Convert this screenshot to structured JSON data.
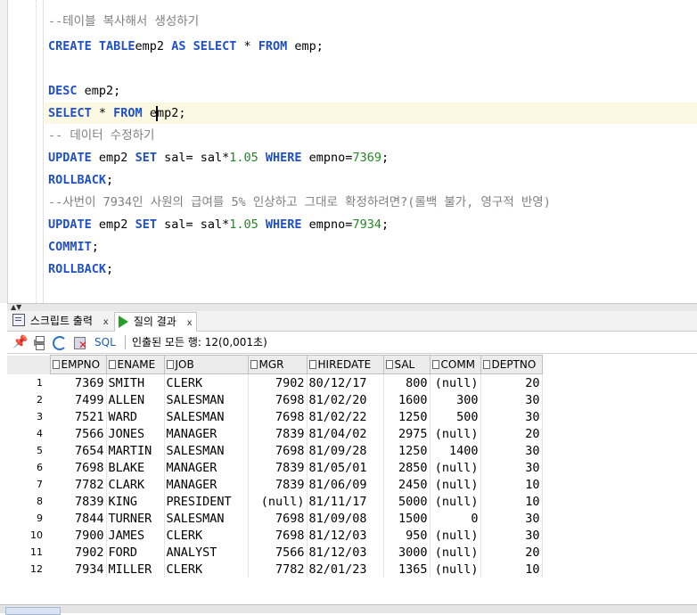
{
  "editor": {
    "lines": [
      {
        "t": "cm",
        "text": "--테이블 복사해서 생성하기"
      },
      {
        "t": "code",
        "parts": [
          [
            "kw",
            "CREATE TABLE"
          ],
          [
            "",
            "emp2 "
          ],
          [
            "kw",
            "AS SELECT"
          ],
          [
            "",
            " * "
          ],
          [
            "kw",
            "FROM"
          ],
          [
            "",
            " emp;"
          ]
        ]
      },
      {
        "t": "blank"
      },
      {
        "t": "code",
        "parts": [
          [
            "kw",
            "DESC"
          ],
          [
            "",
            " emp2;"
          ]
        ]
      },
      {
        "t": "code",
        "hl": true,
        "parts": [
          [
            "kw",
            "SELECT"
          ],
          [
            "",
            " * "
          ],
          [
            "kw",
            "FROM"
          ],
          [
            "",
            " e"
          ],
          [
            "caret",
            ""
          ],
          [
            "",
            "mp2;"
          ]
        ]
      },
      {
        "t": "cm",
        "text": "-- 데이터 수정하기"
      },
      {
        "t": "code",
        "parts": [
          [
            "kw",
            "UPDATE"
          ],
          [
            "",
            " emp2 "
          ],
          [
            "kw",
            "SET"
          ],
          [
            "",
            " sal= sal*"
          ],
          [
            "num",
            "1.05"
          ],
          [
            "",
            " "
          ],
          [
            "kw",
            "WHERE"
          ],
          [
            "",
            " empno="
          ],
          [
            "num",
            "7369"
          ],
          [
            "",
            ";"
          ]
        ]
      },
      {
        "t": "code",
        "parts": [
          [
            "kw",
            "ROLLBACK"
          ],
          [
            "",
            ";"
          ]
        ]
      },
      {
        "t": "cm",
        "text": "--사번이 7934인 사원의 급여를 5% 인상하고 그대로 확정하려면?(롤백 불가, 영구적 반영)"
      },
      {
        "t": "code",
        "parts": [
          [
            "kw",
            "UPDATE"
          ],
          [
            "",
            " emp2 "
          ],
          [
            "kw",
            "SET"
          ],
          [
            "",
            " sal= sal*"
          ],
          [
            "num",
            "1.05"
          ],
          [
            "",
            " "
          ],
          [
            "kw",
            "WHERE"
          ],
          [
            "",
            " empno="
          ],
          [
            "num",
            "7934"
          ],
          [
            "",
            ";"
          ]
        ]
      },
      {
        "t": "code",
        "parts": [
          [
            "kw",
            "COMMIT"
          ],
          [
            "",
            ";"
          ]
        ]
      },
      {
        "t": "code",
        "parts": [
          [
            "kw",
            "ROLLBACK"
          ],
          [
            "",
            ";"
          ]
        ]
      }
    ]
  },
  "tabs": [
    {
      "label": "스크립트 출력",
      "close": "x"
    },
    {
      "label": "질의 결과",
      "close": "x"
    }
  ],
  "toolbar": {
    "sql_label": "SQL",
    "status": "인출된 모든 행: 12(0,001초)"
  },
  "grid": {
    "columns": [
      "EMPNO",
      "ENAME",
      "JOB",
      "MGR",
      "HIREDATE",
      "SAL",
      "COMM",
      "DEPTNO"
    ],
    "rows": [
      [
        "1",
        "7369",
        "SMITH",
        "CLERK",
        "7902",
        "80/12/17",
        "800",
        "(null)",
        "20"
      ],
      [
        "2",
        "7499",
        "ALLEN",
        "SALESMAN",
        "7698",
        "81/02/20",
        "1600",
        "300",
        "30"
      ],
      [
        "3",
        "7521",
        "WARD",
        "SALESMAN",
        "7698",
        "81/02/22",
        "1250",
        "500",
        "30"
      ],
      [
        "4",
        "7566",
        "JONES",
        "MANAGER",
        "7839",
        "81/04/02",
        "2975",
        "(null)",
        "20"
      ],
      [
        "5",
        "7654",
        "MARTIN",
        "SALESMAN",
        "7698",
        "81/09/28",
        "1250",
        "1400",
        "30"
      ],
      [
        "6",
        "7698",
        "BLAKE",
        "MANAGER",
        "7839",
        "81/05/01",
        "2850",
        "(null)",
        "30"
      ],
      [
        "7",
        "7782",
        "CLARK",
        "MANAGER",
        "7839",
        "81/06/09",
        "2450",
        "(null)",
        "10"
      ],
      [
        "8",
        "7839",
        "KING",
        "PRESIDENT",
        "(null)",
        "81/11/17",
        "5000",
        "(null)",
        "10"
      ],
      [
        "9",
        "7844",
        "TURNER",
        "SALESMAN",
        "7698",
        "81/09/08",
        "1500",
        "0",
        "30"
      ],
      [
        "10",
        "7900",
        "JAMES",
        "CLERK",
        "7698",
        "81/12/03",
        "950",
        "(null)",
        "30"
      ],
      [
        "11",
        "7902",
        "FORD",
        "ANALYST",
        "7566",
        "81/12/03",
        "3000",
        "(null)",
        "20"
      ],
      [
        "12",
        "7934",
        "MILLER",
        "CLERK",
        "7782",
        "82/01/23",
        "1365",
        "(null)",
        "10"
      ]
    ]
  },
  "colors": {
    "keyword": "#2050c8",
    "comment": "#808080",
    "number": "#1f8b1f",
    "highlight_line": "#fcf9e3"
  }
}
